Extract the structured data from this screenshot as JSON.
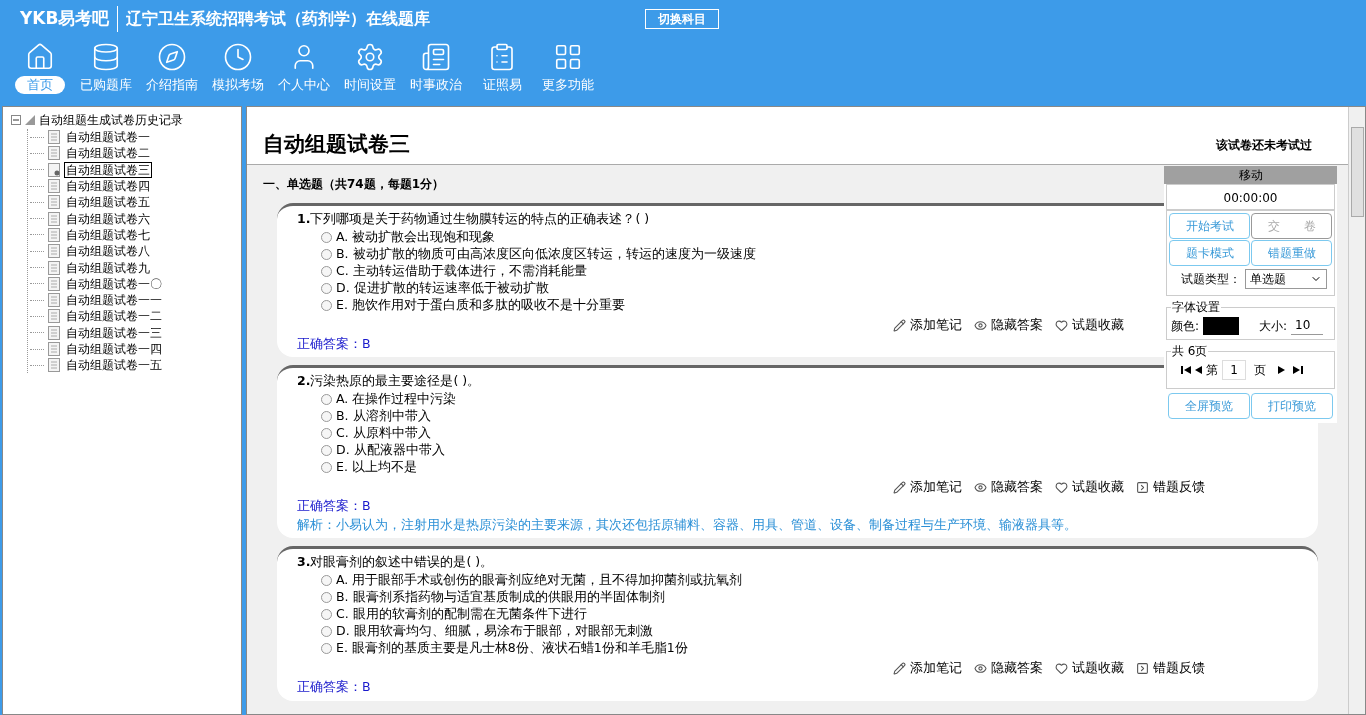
{
  "header": {
    "logo": "YKB易考吧",
    "title": "辽宁卫生系统招聘考试（药剂学）在线题库",
    "switch_button": "切换科目"
  },
  "nav": [
    {
      "label": "首页",
      "selected": true
    },
    {
      "label": "已购题库",
      "selected": false
    },
    {
      "label": "介绍指南",
      "selected": false
    },
    {
      "label": "模拟考场",
      "selected": false
    },
    {
      "label": "个人中心",
      "selected": false
    },
    {
      "label": "时间设置",
      "selected": false
    },
    {
      "label": "时事政治",
      "selected": false
    },
    {
      "label": "证照易",
      "selected": false
    },
    {
      "label": "更多功能",
      "selected": false
    }
  ],
  "tree": {
    "label": "自动组题生成试卷历史记录",
    "expanded": true,
    "children": [
      {
        "label": "自动组题试卷一",
        "selected": false
      },
      {
        "label": "自动组题试卷二",
        "selected": false
      },
      {
        "label": "自动组题试卷三",
        "selected": true
      },
      {
        "label": "自动组题试卷四",
        "selected": false
      },
      {
        "label": "自动组题试卷五",
        "selected": false
      },
      {
        "label": "自动组题试卷六",
        "selected": false
      },
      {
        "label": "自动组题试卷七",
        "selected": false
      },
      {
        "label": "自动组题试卷八",
        "selected": false
      },
      {
        "label": "自动组题试卷九",
        "selected": false
      },
      {
        "label": "自动组题试卷一〇",
        "selected": false
      },
      {
        "label": "自动组题试卷一一",
        "selected": false
      },
      {
        "label": "自动组题试卷一二",
        "selected": false
      },
      {
        "label": "自动组题试卷一三",
        "selected": false
      },
      {
        "label": "自动组题试卷一四",
        "selected": false
      },
      {
        "label": "自动组题试卷一五",
        "selected": false
      }
    ]
  },
  "paper": {
    "title": "自动组题试卷三",
    "status": "该试卷还未考试过",
    "section": "一、单选题（共74题，每题1分）",
    "questions": [
      {
        "number": "1.",
        "text": "下列哪项是关于药物通过生物膜转运的特点的正确表述？( )",
        "options": [
          {
            "label": "A. 被动扩散会出现饱和现象",
            "selected": false
          },
          {
            "label": "B. 被动扩散的物质可由高浓度区向低浓度区转运，转运的速度为一级速度",
            "selected": false
          },
          {
            "label": "C. 主动转运借助于载体进行，不需消耗能量",
            "selected": false
          },
          {
            "label": "D. 促进扩散的转运速率低于被动扩散",
            "selected": false
          },
          {
            "label": "E. 胞饮作用对于蛋白质和多肽的吸收不是十分重要",
            "selected": false
          }
        ],
        "actions": [
          "添加笔记",
          "隐藏答案",
          "试题收藏"
        ],
        "answer": "正确答案：B"
      },
      {
        "number": "2.",
        "text": "污染热原的最主要途径是( )。",
        "options": [
          {
            "label": "A. 在操作过程中污染",
            "selected": false
          },
          {
            "label": "B. 从溶剂中带入",
            "selected": false
          },
          {
            "label": "C. 从原料中带入",
            "selected": false
          },
          {
            "label": "D. 从配液器中带入",
            "selected": false
          },
          {
            "label": "E. 以上均不是",
            "selected": false
          }
        ],
        "actions": [
          "添加笔记",
          "隐藏答案",
          "试题收藏",
          "错题反馈"
        ],
        "answer": "正确答案：B",
        "explanation": "解析：小易认为，注射用水是热原污染的主要来源，其次还包括原辅料、容器、用具、管道、设备、制备过程与生产环境、输液器具等。"
      },
      {
        "number": "3.",
        "text": "对眼膏剂的叙述中错误的是( )。",
        "options": [
          {
            "label": "A. 用于眼部手术或创伤的眼膏剂应绝对无菌，且不得加抑菌剂或抗氧剂",
            "selected": false
          },
          {
            "label": "B. 眼膏剂系指药物与适宜基质制成的供眼用的半固体制剂",
            "selected": false
          },
          {
            "label": "C. 眼用的软膏剂的配制需在无菌条件下进行",
            "selected": false
          },
          {
            "label": "D. 眼用软膏均匀、细腻，易涂布于眼部，对眼部无刺激",
            "selected": false
          },
          {
            "label": "E. 眼膏剂的基质主要是凡士林8份、液状石蜡1份和羊毛脂1份",
            "selected": false
          }
        ],
        "actions": [
          "添加笔记",
          "隐藏答案",
          "试题收藏",
          "错题反馈"
        ],
        "answer": "正确答案：B"
      }
    ]
  },
  "panel": {
    "header": "移动",
    "timer": "00:00:00",
    "buttons": [
      {
        "label": "开始考试",
        "disabled": false
      },
      {
        "label": "交　　卷",
        "disabled": true
      },
      {
        "label": "题卡模式",
        "disabled": false
      },
      {
        "label": "错题重做",
        "disabled": false
      }
    ],
    "type_label": "试题类型：",
    "type_value": "单选题",
    "font_group": "字体设置",
    "color_label": "颜色:",
    "color": "#000000",
    "size_label": "大小:",
    "size_value": "10",
    "page_group": "共 6页",
    "page_prefix": "第",
    "page_value": "1",
    "page_suffix": "页",
    "bottom_buttons": [
      "全屏预览",
      "打印预览"
    ]
  }
}
